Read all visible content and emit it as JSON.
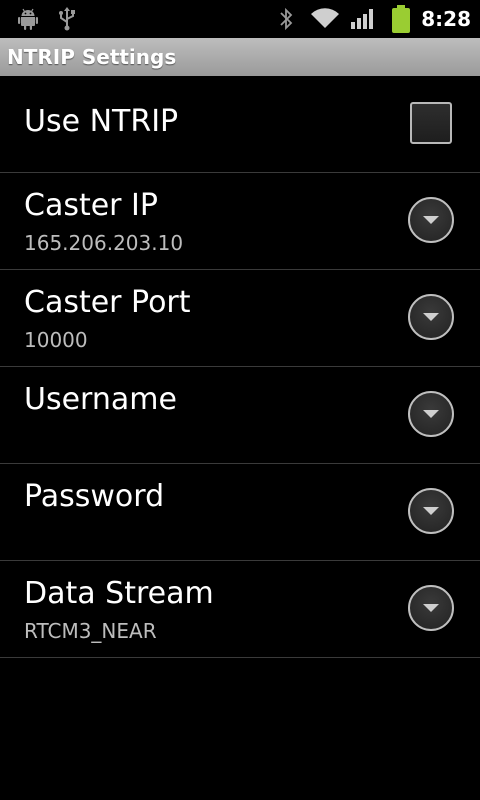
{
  "status_bar": {
    "time": "8:28",
    "icons": [
      "android-icon",
      "usb-icon",
      "bluetooth-icon",
      "wifi-icon",
      "signal-icon",
      "battery-icon"
    ]
  },
  "title_bar": {
    "title": "NTRIP Settings"
  },
  "preferences": [
    {
      "title": "Use NTRIP",
      "summary": "",
      "widget": "checkbox",
      "checked": false
    },
    {
      "title": "Caster IP",
      "summary": "165.206.203.10",
      "widget": "dropdown"
    },
    {
      "title": "Caster Port",
      "summary": "10000",
      "widget": "dropdown"
    },
    {
      "title": "Username",
      "summary": "",
      "widget": "dropdown"
    },
    {
      "title": "Password",
      "summary": "",
      "widget": "dropdown"
    },
    {
      "title": "Data Stream",
      "summary": "RTCM3_NEAR",
      "widget": "dropdown"
    }
  ],
  "colors": {
    "background": "#000000",
    "title_bar": "#a8a8a8",
    "battery": "#9acd32",
    "summary_text": "#bdbdbd"
  }
}
